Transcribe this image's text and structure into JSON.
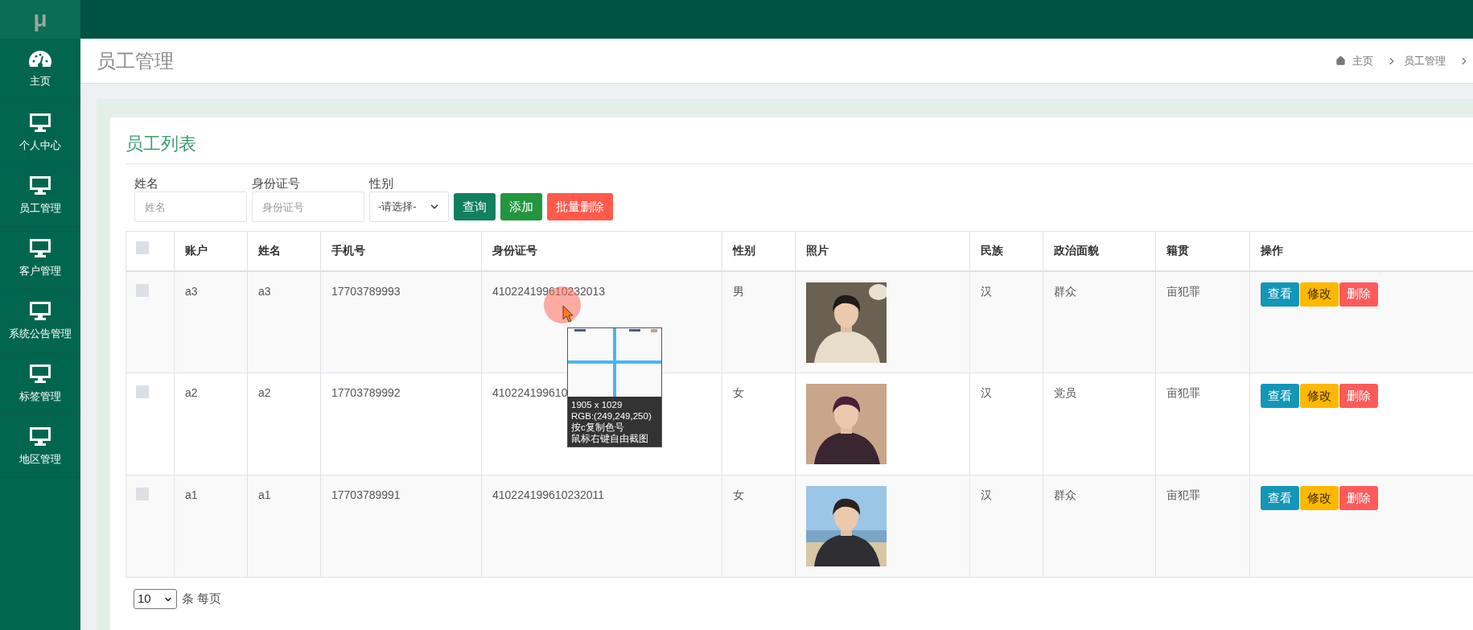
{
  "sidebar": {
    "logo": "μ",
    "items": [
      {
        "label": "主页",
        "kind": "gauge"
      },
      {
        "label": "个人中心",
        "kind": "monitor"
      },
      {
        "label": "员工管理",
        "kind": "monitor"
      },
      {
        "label": "客户管理",
        "kind": "monitor"
      },
      {
        "label": "系统公告管理",
        "kind": "monitor"
      },
      {
        "label": "标签管理",
        "kind": "monitor"
      },
      {
        "label": "地区管理",
        "kind": "monitor"
      }
    ]
  },
  "header": {
    "title": "员工管理",
    "breadcrumb": [
      "主页",
      "员工管理"
    ]
  },
  "card": {
    "title": "员工列表",
    "filters": [
      {
        "label": "姓名",
        "kind": "text",
        "placeholder": "姓名"
      },
      {
        "label": "身份证号",
        "kind": "text",
        "placeholder": "身份证号"
      },
      {
        "label": "性别",
        "kind": "select",
        "value": "-请选择-"
      }
    ],
    "buttons": [
      {
        "label": "查询",
        "kind": "search"
      },
      {
        "label": "添加",
        "kind": "add"
      },
      {
        "label": "批量删除",
        "kind": "delete"
      }
    ]
  },
  "table": {
    "header_checked": false,
    "columns": [
      "账户",
      "姓名",
      "手机号",
      "身份证号",
      "性别",
      "照片",
      "民族",
      "政治面貌",
      "籍贯",
      "操作"
    ],
    "rows": [
      {
        "checked": false,
        "account": "a3",
        "name": "a3",
        "phone": "17703789993",
        "id_number": "410224199610232013",
        "gender": "男",
        "ethnicity": "汉",
        "politics": "群众",
        "origin": "亩犯罪",
        "actions": [
          {
            "label": "查看",
            "kind": "view"
          },
          {
            "label": "修改",
            "kind": "edit"
          },
          {
            "label": "删除",
            "kind": "delete"
          }
        ]
      },
      {
        "checked": false,
        "account": "a2",
        "name": "a2",
        "phone": "17703789992",
        "id_number": "410224199610",
        "gender": "女",
        "ethnicity": "汉",
        "politics": "党员",
        "origin": "亩犯罪",
        "actions": [
          {
            "label": "查看",
            "kind": "view"
          },
          {
            "label": "修改",
            "kind": "edit"
          },
          {
            "label": "删除",
            "kind": "delete"
          }
        ]
      },
      {
        "checked": false,
        "account": "a1",
        "name": "a1",
        "phone": "17703789991",
        "id_number": "410224199610232011",
        "gender": "女",
        "ethnicity": "汉",
        "politics": "群众",
        "origin": "亩犯罪",
        "actions": [
          {
            "label": "查看",
            "kind": "view"
          },
          {
            "label": "修改",
            "kind": "edit"
          },
          {
            "label": "删除",
            "kind": "delete"
          }
        ]
      }
    ]
  },
  "pagination": {
    "page_size": "10",
    "suffix": "条 每页"
  },
  "color_picker": {
    "size": "1905 x 1029",
    "rgb": "RGB:(249,249,250)",
    "hints": [
      "按c复制色号",
      "鼠标右键自由截图"
    ]
  }
}
